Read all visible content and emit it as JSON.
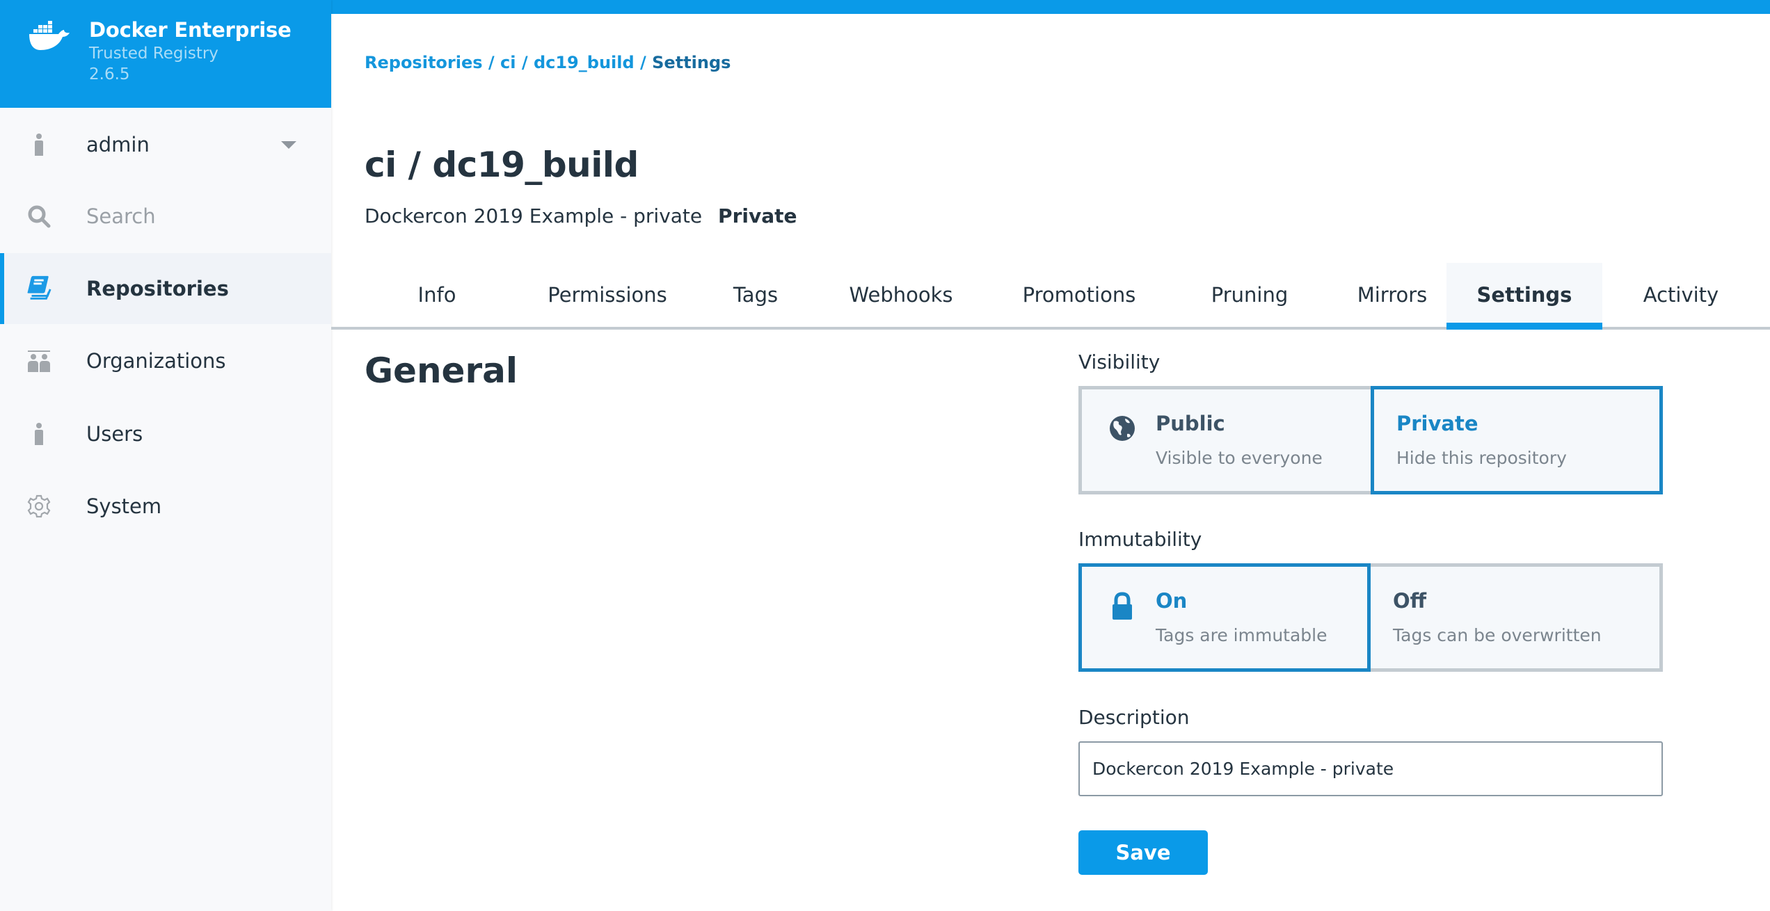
{
  "brand": {
    "title": "Docker Enterprise",
    "subtitle": "Trusted Registry",
    "version": "2.6.5",
    "logo_icon": "docker-whale-icon",
    "color": "#0a9ae8"
  },
  "sidebar": {
    "user": {
      "label": "admin",
      "icon": "user-icon",
      "menu_icon": "caret-down-icon"
    },
    "search": {
      "placeholder": "Search",
      "icon": "search-icon"
    },
    "items": [
      {
        "label": "Repositories",
        "icon": "repositories-icon",
        "active": true
      },
      {
        "label": "Organizations",
        "icon": "organizations-icon",
        "active": false
      },
      {
        "label": "Users",
        "icon": "user-icon",
        "active": false
      },
      {
        "label": "System",
        "icon": "gear-icon",
        "active": false
      }
    ]
  },
  "breadcrumb": {
    "items": [
      "Repositories",
      "ci",
      "dc19_build",
      "Settings"
    ],
    "separator": "/"
  },
  "header": {
    "title": "ci / dc19_build",
    "description": "Dockercon 2019 Example - private",
    "visibility_badge": "Private"
  },
  "tabs": [
    {
      "label": "Info",
      "active": false
    },
    {
      "label": "Permissions",
      "active": false
    },
    {
      "label": "Tags",
      "active": false
    },
    {
      "label": "Webhooks",
      "active": false
    },
    {
      "label": "Promotions",
      "active": false
    },
    {
      "label": "Pruning",
      "active": false
    },
    {
      "label": "Mirrors",
      "active": false
    },
    {
      "label": "Settings",
      "active": true
    },
    {
      "label": "Activity",
      "active": false
    }
  ],
  "settings": {
    "section_title": "General",
    "visibility": {
      "label": "Visibility",
      "options": [
        {
          "title": "Public",
          "description": "Visible to everyone",
          "icon": "globe-icon",
          "selected": false
        },
        {
          "title": "Private",
          "description": "Hide this repository",
          "selected": true
        }
      ]
    },
    "immutability": {
      "label": "Immutability",
      "options": [
        {
          "title": "On",
          "description": "Tags are immutable",
          "icon": "lock-icon",
          "selected": true
        },
        {
          "title": "Off",
          "description": "Tags can be overwritten",
          "selected": false
        }
      ]
    },
    "description": {
      "label": "Description",
      "value": "Dockercon 2019 Example - private"
    },
    "save_label": "Save"
  },
  "colors": {
    "accent": "#0a9ae8",
    "selected_border": "#1a86c5",
    "text": "#253440"
  }
}
